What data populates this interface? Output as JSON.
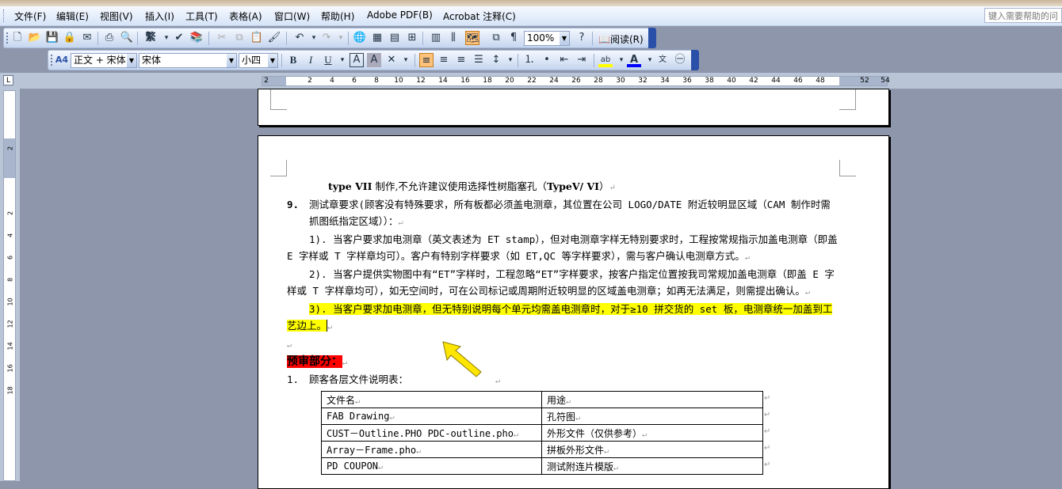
{
  "menubar": {
    "items": [
      "文件(F)",
      "编辑(E)",
      "视图(V)",
      "插入(I)",
      "工具(T)",
      "表格(A)",
      "窗口(W)",
      "帮助(H)",
      "Adobe PDF(B)",
      "Acrobat 注释(C)"
    ],
    "help_placeholder": "键入需要帮助的问"
  },
  "standard_toolbar": {
    "zoom": "100%",
    "reading_label": "阅读(R)",
    "icons": [
      "new-icon",
      "open-icon",
      "save-icon",
      "permission-icon",
      "print-preview-icon",
      "print-icon",
      "preview-icon",
      "traditional-chinese-icon",
      "spelling-icon",
      "research-icon",
      "cut-icon",
      "copy-icon",
      "paste-icon",
      "format-painter-icon",
      "undo-icon",
      "redo-icon",
      "hyperlink-icon",
      "tables-borders-icon",
      "insert-table-icon",
      "insert-excel-icon",
      "columns-icon",
      "drawing-icon",
      "document-map-icon",
      "show-hide-icon",
      "help-icon"
    ]
  },
  "format_toolbar": {
    "style": "正文 + 宋体",
    "font": "宋体",
    "size": "小四",
    "bold": "B",
    "italic": "I",
    "underline": "U",
    "char_border": "A",
    "char_shading": "A",
    "highlight_color": "#ffff00",
    "font_color": "#0000ff"
  },
  "ruler": {
    "numbers": [
      "2",
      "2",
      "4",
      "6",
      "8",
      "10",
      "12",
      "14",
      "16",
      "18",
      "20",
      "22",
      "24",
      "26",
      "28",
      "30",
      "32",
      "34",
      "36",
      "38",
      "40",
      "42",
      "44",
      "46",
      "48",
      "52",
      "54"
    ],
    "v_numbers": [
      "2",
      "2",
      "4",
      "6",
      "8",
      "10",
      "12",
      "14",
      "16",
      "18"
    ]
  },
  "document": {
    "line0_bold1": "type VII",
    "line0_text": " 制作,不允许建议使用选择性树脂塞孔（",
    "line0_bold2": "TypeV/ VI",
    "line0_end": "）",
    "item9_num": "9.",
    "item9_text": "测试章要求(顾客没有特殊要求，所有板都必须盖电测章，其位置在公司 LOGO/DATE 附近较明显区域（CAM 制作时需抓图纸指定区域））：",
    "p1": "1). 当客户要求加电测章（英文表述为 ET stamp），但对电测章字样无特别要求时，工程按常规指示加盖电测章（即盖 E 字样或 T 字样章均可）。客户有特别字样要求（如 ET,QC 等字样要求），需与客户确认电测章方式。",
    "p2": "2). 当客户提供实物图中有“ET”字样时，工程忽略“ET”字样要求，按客户指定位置按我司常规加盖电测章（即盖 E 字样或 T 字样章均可），如无空间时，可在公司标记或周期附近较明显的区域盖电测章；如再无法满足，则需提出确认。",
    "p3": "3). 当客户要求加电测章，但无特别说明每个单元均需盖电测章时，对于≥10 拼交货的 set 板，电测章统一加盖到工艺边上。",
    "pre_review": "预审部分：",
    "list1_num": "1.",
    "list1_text": "顾客各层文件说明表：",
    "table_header": [
      "文件名",
      "用途"
    ],
    "table_rows": [
      [
        "FAB Drawing",
        "孔符图"
      ],
      [
        "CUST－Outline.PHO    PDC-outline.pho",
        "外形文件（仅供参考）"
      ],
      [
        "Array－Frame.pho",
        "拼板外形文件"
      ],
      [
        "PD COUPON",
        "测试附连片模版"
      ]
    ],
    "para_mark": "↵"
  }
}
